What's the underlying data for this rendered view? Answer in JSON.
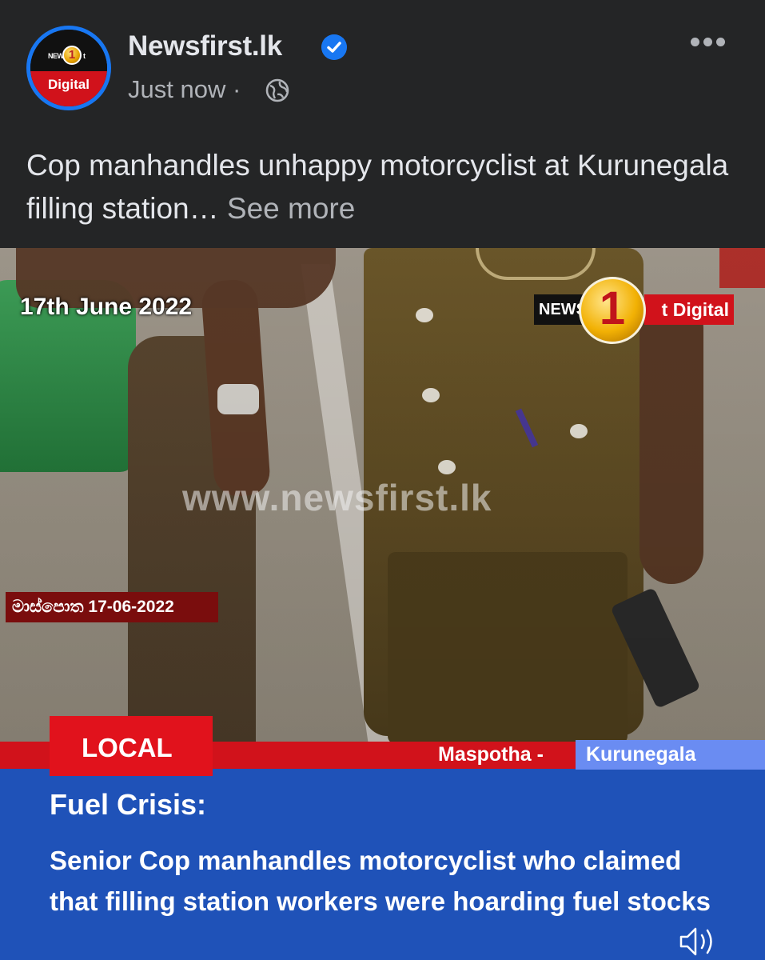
{
  "post": {
    "page_name": "Newsfirst.lk",
    "verified_icon": "verified-badge-icon",
    "timestamp": "Just now",
    "separator": "·",
    "privacy_icon": "globe-icon",
    "more_icon": "more-options-icon",
    "avatar": {
      "top_left": "NEW",
      "top_right": "t",
      "bottom": "Digital",
      "disc": "1"
    },
    "text": "Cop manhandles unhappy motorcyclist at Kurunegala filling station…",
    "see_more": "See more"
  },
  "video": {
    "date_overlay": "17th June 2022",
    "brand": {
      "news": "NEWS",
      "digital": "t Digital",
      "disc": "1"
    },
    "watermark": "www.newsfirst.lk",
    "sinhala_date": "මාස්පොත 17-06-2022",
    "tag": "LOCAL",
    "location_primary": "Maspotha -",
    "location_secondary": "Kurunegala",
    "headline": "Fuel Crisis:",
    "story": "Senior Cop manhandles motorcyclist who claimed that filling station workers were hoarding fuel stocks",
    "speaker_icon": "speaker-icon"
  },
  "colors": {
    "background": "#242526",
    "accent_blue": "#1877f2",
    "news_red": "#d1121b",
    "news_blue": "#1f52b8",
    "location_blue": "#6a8cf2"
  }
}
